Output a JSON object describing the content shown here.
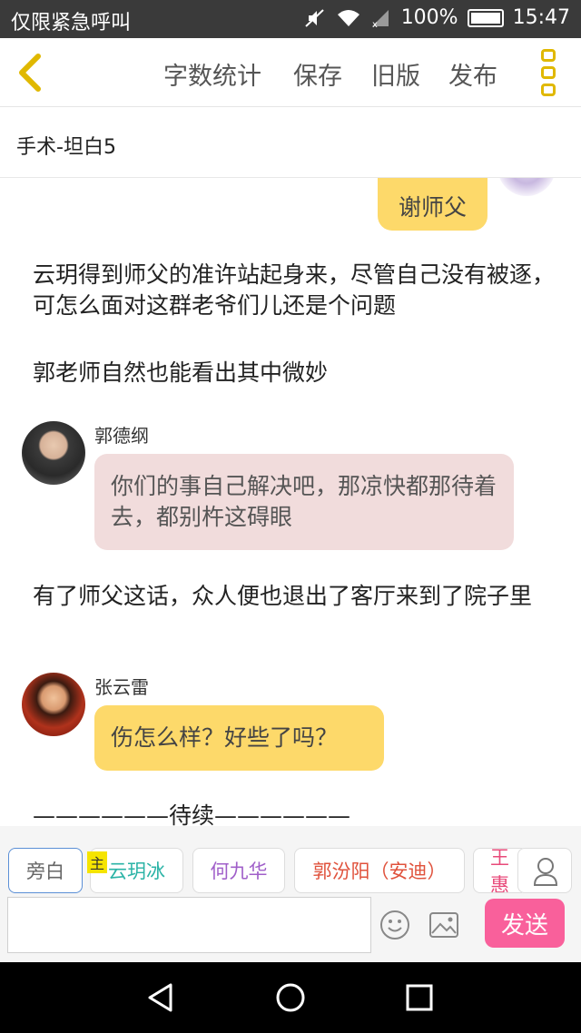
{
  "status_bar": {
    "carrier_text": "仅限紧急呼叫",
    "battery": "100%",
    "time": "15:47"
  },
  "toolbar": {
    "word_count": "字数统计",
    "save": "保存",
    "old_version": "旧版",
    "publish": "发布"
  },
  "document": {
    "title": "手术-坦白5"
  },
  "story": {
    "top_bubble": "谢师父",
    "narration_1": "云玥得到师父的准许站起身来，尽管自己没有被逐，可怎么面对这群老爷们儿还是个问题",
    "narration_2": "郭老师自然也能看出其中微妙",
    "msg_1_speaker": "郭德纲",
    "msg_1_text": "你们的事自己解决吧，那凉快都那待着去，都别杵这碍眼",
    "narration_3": "有了师父这话，众人便也退出了客厅来到了院子里",
    "msg_2_speaker": "张云雷",
    "msg_2_text": "伤怎么样？好些了吗？",
    "ending": "——————待续——————"
  },
  "characters": {
    "narrator": "旁白",
    "host_tag": "主",
    "c1": "云玥冰",
    "c2": "何九华",
    "c3": "郭汾阳（安迪）",
    "c4": "王惠"
  },
  "input": {
    "placeholder": "",
    "send": "发送"
  },
  "colors": {
    "accent_yellow": "#fdd96a",
    "pink_bubble": "#f1dcdc",
    "send_pink": "#f9609b",
    "char_teal": "#2ab3a6",
    "char_purple": "#a05fc9",
    "char_red": "#e0523c",
    "char_pink": "#e84a7a"
  },
  "icons": [
    "back-chevron-icon",
    "more-icon",
    "user-icon",
    "emoji-icon",
    "image-icon",
    "nav-back-icon",
    "nav-home-icon",
    "nav-recent-icon"
  ]
}
